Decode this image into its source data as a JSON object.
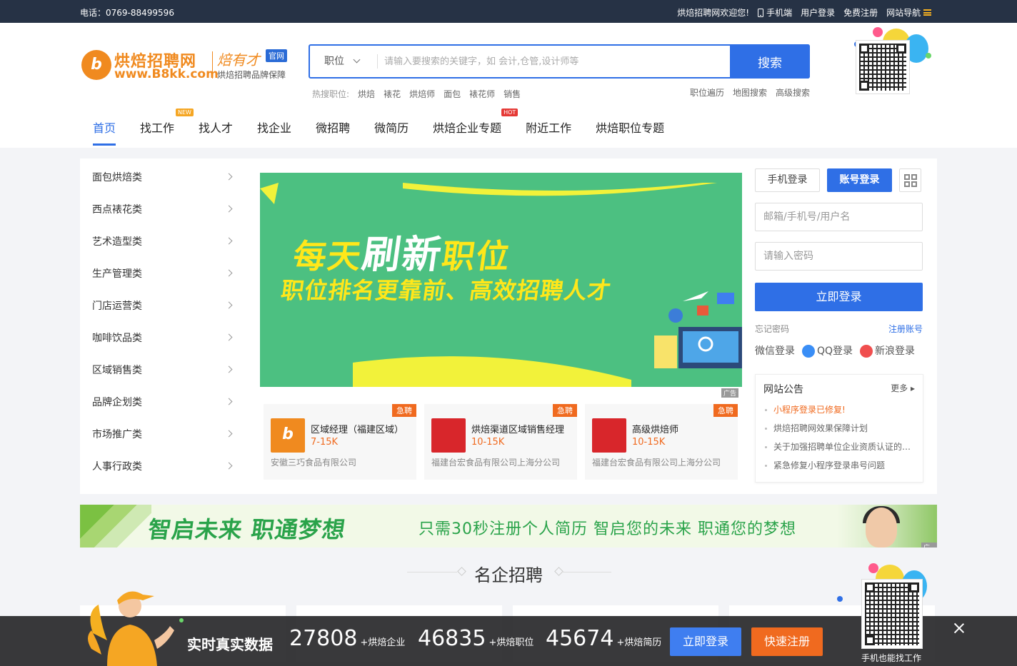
{
  "topbar": {
    "phone": "电话：0769-88499596",
    "welcome": "烘焙招聘网欢迎您!",
    "mobile": "手机端",
    "user_login": "用户登录",
    "free_register": "免费注册",
    "site_nav": "网站导航"
  },
  "logo": {
    "name": "烘焙招聘网",
    "url": "www.B8kk.com",
    "brand": "焙有才",
    "badge": "官网",
    "tagline": "烘焙招聘品牌保障"
  },
  "search": {
    "type": "职位",
    "placeholder": "请输入要搜索的关键字，如 会计,仓管,设计师等",
    "button": "搜索",
    "hot_label": "热搜职位:",
    "hot_items": [
      "烘焙",
      "裱花",
      "烘焙师",
      "面包",
      "裱花师",
      "销售"
    ],
    "advanced": [
      "职位遍历",
      "地图搜索",
      "高级搜索"
    ]
  },
  "nav": {
    "items": [
      "首页",
      "找工作",
      "找人才",
      "找企业",
      "微招聘",
      "微简历",
      "烘焙企业专题",
      "附近工作",
      "烘焙职位专题"
    ],
    "new_tag": "NEW",
    "hot_tag": "HOT"
  },
  "categories": [
    "面包烘焙类",
    "西点裱花类",
    "艺术造型类",
    "生产管理类",
    "门店运营类",
    "咖啡饮品类",
    "区域销售类",
    "品牌企划类",
    "市场推广类",
    "人事行政类"
  ],
  "banner": {
    "line1_a": "每天",
    "line1_b": "刷新",
    "line1_c": "职位",
    "line2": "职位排名更靠前、高效招聘人才",
    "ad": "广告"
  },
  "jobs": [
    {
      "title": "区域经理（福建区域）",
      "salary": "7-15K",
      "company": "安徽三巧食品有限公司",
      "urgent": "急聘"
    },
    {
      "title": "烘焙渠道区域销售经理",
      "salary": "10-15K",
      "company": "福建台宏食品有限公司上海分公司",
      "urgent": "急聘"
    },
    {
      "title": "高级烘焙师",
      "salary": "10-15K",
      "company": "福建台宏食品有限公司上海分公司",
      "urgent": "急聘"
    }
  ],
  "login": {
    "tab_phone": "手机登录",
    "tab_account": "账号登录",
    "username_placeholder": "邮箱/手机号/用户名",
    "password_placeholder": "请输入密码",
    "submit": "立即登录",
    "forgot": "忘记密码",
    "register": "注册账号",
    "wechat": "微信登录",
    "qq": "QQ登录",
    "weibo": "新浪登录"
  },
  "notice": {
    "title": "网站公告",
    "more": "更多",
    "items": [
      "小程序登录已修复!",
      "烘焙招聘网效果保障计划",
      "关于加强招聘单位企业资质认证的通知",
      "紧急修复小程序登录串号问题"
    ]
  },
  "banner2": {
    "title": "智启未来 职通梦想",
    "subtitle": "只需30秒注册个人简历 智启您的未来 职通您的梦想",
    "ad": "广告"
  },
  "section_title": "名企招聘",
  "bottom_bar": {
    "slogan": "实时真实数据",
    "stats": [
      {
        "num": "27808",
        "unit": "+烘焙企业"
      },
      {
        "num": "46835",
        "unit": "+烘焙职位"
      },
      {
        "num": "45674",
        "unit": "+烘焙简历"
      }
    ],
    "login": "立即登录",
    "register": "快速注册",
    "qr_label": "手机也能找工作"
  },
  "colors": {
    "primary": "#2f6fe6",
    "accent": "#f06a1f",
    "topbar": "#263245",
    "banner_green": "#4cc081"
  }
}
